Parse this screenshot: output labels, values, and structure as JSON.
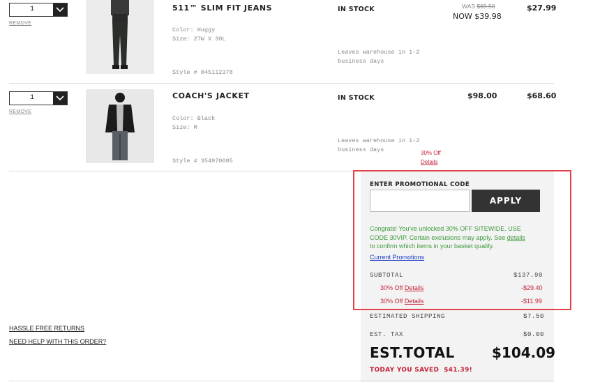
{
  "items": [
    {
      "qty": "1",
      "remove_label": "REMOVE",
      "name": "511™ SLIM FIT JEANS",
      "color": "Color:  Huggy",
      "size": "Size:  27W X 30L",
      "style": "Style #  045112378",
      "stock": "IN STOCK",
      "leaves": "Leaves warehouse in 1-2 business days",
      "was_label": "WAS ",
      "was_price": "$69.50",
      "now_price": "NOW $39.98",
      "total": "$27.99"
    },
    {
      "qty": "1",
      "remove_label": "REMOVE",
      "name": "COACH'S JACKET",
      "color": "Color:  Black",
      "size": "Size:  M",
      "style": "Style #  354970005",
      "stock": "IN STOCK",
      "leaves": "Leaves warehouse in 1-2 business days",
      "price": "$98.00",
      "total": "$68.60",
      "promo": "30% Off",
      "promo_details": "Details"
    }
  ],
  "promo": {
    "title": "ENTER PROMOTIONAL CODE",
    "input_value": "",
    "apply_label": "APPLY",
    "congrats_text": "Congrats! You've unlocked 30% OFF SITEWIDE. USE CODE 30VIP. Certain exclusions may apply. See",
    "details_link": "details",
    "congrats_tail": " to confirm which items in your basket qualify.",
    "current_promotions": "Current Promotions"
  },
  "summary": {
    "subtotal_label": "SUBTOTAL",
    "subtotal": "$137.98",
    "discounts": [
      {
        "label": "30% Off",
        "details": "Details",
        "amount": "-$29.40"
      },
      {
        "label": "30% Off",
        "details": "Details",
        "amount": "-$11.99"
      }
    ],
    "shipping_label": "ESTIMATED SHIPPING",
    "shipping": "$7.50",
    "tax_label": "EST. TAX",
    "tax": "$0.00",
    "total_label": "EST.TOTAL",
    "total": "$104.09",
    "saved_label": "TODAY YOU SAVED",
    "saved": "$41.39!"
  },
  "links": {
    "returns": "HASSLE FREE RETURNS",
    "help": "NEED HELP WITH THIS ORDER?"
  },
  "colors": {
    "accent_red": "#c4243b",
    "promo_green": "#3c9a3c",
    "highlight_border": "#e0434b"
  }
}
